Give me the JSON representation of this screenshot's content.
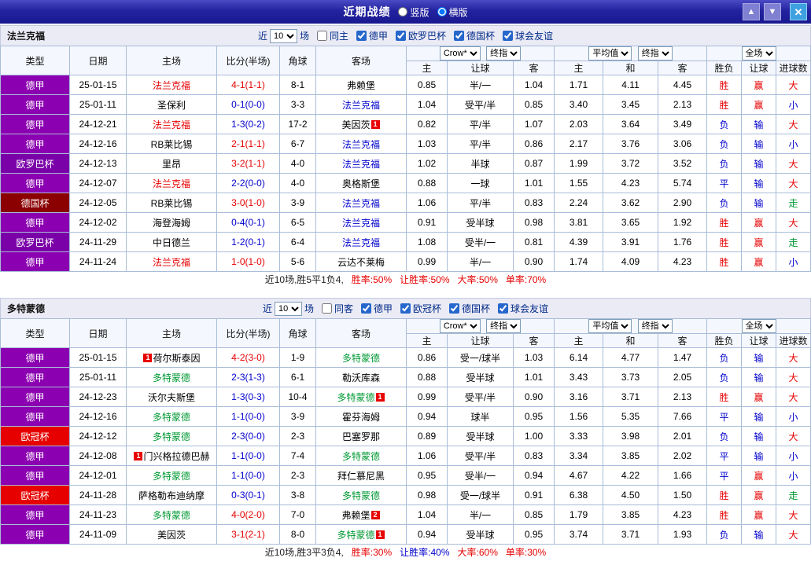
{
  "titlebar": {
    "title": "近期战绩",
    "vertical_label": "竖版",
    "horizontal_label": "横版",
    "vertical_selected": false,
    "horizontal_selected": true,
    "up_icon": "▲",
    "down_icon": "▼",
    "close_icon": "✕"
  },
  "tone_colors": {
    "red": "#E60000",
    "blue": "#0000CC",
    "green": "#009933",
    "dark": "#222222"
  },
  "league_colors": {
    "德甲": "#8B00B0",
    "欧罗巴杯": "#7A00A8",
    "德国杯": "#8B0000",
    "欧冠杯": "#E60000"
  },
  "filter_common": {
    "near_label": "近",
    "count_value": "10",
    "count_suffix": "场"
  },
  "table_header": {
    "type": "类型",
    "date": "日期",
    "home": "主场",
    "score": "比分(半场)",
    "corner": "角球",
    "away": "客场",
    "odds_company_select": "Crow*",
    "odds_time_select": "终指",
    "avg_select": "平均值",
    "avg_time_select": "终指",
    "fulltime_select": "全场",
    "odds_sub": [
      "主",
      "让球",
      "客"
    ],
    "avg_sub": [
      "主",
      "和",
      "客"
    ],
    "result_sub": [
      "胜负",
      "让球",
      "进球数"
    ]
  },
  "sections": [
    {
      "team": "法兰克福",
      "same_filter": {
        "label": "同主",
        "checked": false
      },
      "league_filters": [
        {
          "label": "德甲",
          "checked": true
        },
        {
          "label": "欧罗巴杯",
          "checked": true
        },
        {
          "label": "德国杯",
          "checked": true
        },
        {
          "label": "球会友谊",
          "checked": true
        }
      ],
      "rows": [
        {
          "league": "德甲",
          "date": "25-01-15",
          "home": {
            "name": "法兰克福",
            "tone": "red"
          },
          "score": {
            "text": "4-1(1-1)",
            "tone": "red"
          },
          "corner": "8-1",
          "away": {
            "name": "弗赖堡"
          },
          "odds": [
            "0.85",
            "半/一",
            "1.04"
          ],
          "avg": [
            "1.71",
            "4.11",
            "4.45"
          ],
          "results": [
            {
              "text": "胜",
              "tone": "red"
            },
            {
              "text": "赢",
              "tone": "red"
            },
            {
              "text": "大",
              "tone": "red"
            }
          ]
        },
        {
          "league": "德甲",
          "date": "25-01-11",
          "home": {
            "name": "圣保利"
          },
          "score": {
            "text": "0-1(0-0)",
            "tone": "blue"
          },
          "corner": "3-3",
          "away": {
            "name": "法兰克福",
            "tone": "blue"
          },
          "odds": [
            "1.04",
            "受平/半",
            "0.85"
          ],
          "avg": [
            "3.40",
            "3.45",
            "2.13"
          ],
          "results": [
            {
              "text": "胜",
              "tone": "red"
            },
            {
              "text": "赢",
              "tone": "red"
            },
            {
              "text": "小",
              "tone": "blue"
            }
          ]
        },
        {
          "league": "德甲",
          "date": "24-12-21",
          "home": {
            "name": "法兰克福",
            "tone": "red"
          },
          "score": {
            "text": "1-3(0-2)",
            "tone": "blue"
          },
          "corner": "17-2",
          "away": {
            "name": "美因茨",
            "badge_after": "1"
          },
          "odds": [
            "0.82",
            "平/半",
            "1.07"
          ],
          "avg": [
            "2.03",
            "3.64",
            "3.49"
          ],
          "results": [
            {
              "text": "负",
              "tone": "blue"
            },
            {
              "text": "输",
              "tone": "blue"
            },
            {
              "text": "大",
              "tone": "red"
            }
          ]
        },
        {
          "league": "德甲",
          "date": "24-12-16",
          "home": {
            "name": "RB莱比锡"
          },
          "score": {
            "text": "2-1(1-1)",
            "tone": "red"
          },
          "corner": "6-7",
          "away": {
            "name": "法兰克福",
            "tone": "blue"
          },
          "odds": [
            "1.03",
            "平/半",
            "0.86"
          ],
          "avg": [
            "2.17",
            "3.76",
            "3.06"
          ],
          "results": [
            {
              "text": "负",
              "tone": "blue"
            },
            {
              "text": "输",
              "tone": "blue"
            },
            {
              "text": "小",
              "tone": "blue"
            }
          ]
        },
        {
          "league": "欧罗巴杯",
          "date": "24-12-13",
          "home": {
            "name": "里昂"
          },
          "score": {
            "text": "3-2(1-1)",
            "tone": "red"
          },
          "corner": "4-0",
          "away": {
            "name": "法兰克福",
            "tone": "blue"
          },
          "odds": [
            "1.02",
            "半球",
            "0.87"
          ],
          "avg": [
            "1.99",
            "3.72",
            "3.52"
          ],
          "results": [
            {
              "text": "负",
              "tone": "blue"
            },
            {
              "text": "输",
              "tone": "blue"
            },
            {
              "text": "大",
              "tone": "red"
            }
          ]
        },
        {
          "league": "德甲",
          "date": "24-12-07",
          "home": {
            "name": "法兰克福",
            "tone": "red"
          },
          "score": {
            "text": "2-2(0-0)",
            "tone": "blue"
          },
          "corner": "4-0",
          "away": {
            "name": "奥格斯堡"
          },
          "odds": [
            "0.88",
            "一球",
            "1.01"
          ],
          "avg": [
            "1.55",
            "4.23",
            "5.74"
          ],
          "results": [
            {
              "text": "平",
              "tone": "blue"
            },
            {
              "text": "输",
              "tone": "blue"
            },
            {
              "text": "大",
              "tone": "red"
            }
          ]
        },
        {
          "league": "德国杯",
          "date": "24-12-05",
          "home": {
            "name": "RB莱比锡"
          },
          "score": {
            "text": "3-0(1-0)",
            "tone": "red"
          },
          "corner": "3-9",
          "away": {
            "name": "法兰克福",
            "tone": "blue"
          },
          "odds": [
            "1.06",
            "平/半",
            "0.83"
          ],
          "avg": [
            "2.24",
            "3.62",
            "2.90"
          ],
          "results": [
            {
              "text": "负",
              "tone": "blue"
            },
            {
              "text": "输",
              "tone": "blue"
            },
            {
              "text": "走",
              "tone": "green"
            }
          ]
        },
        {
          "league": "德甲",
          "date": "24-12-02",
          "home": {
            "name": "海登海姆"
          },
          "score": {
            "text": "0-4(0-1)",
            "tone": "blue"
          },
          "corner": "6-5",
          "away": {
            "name": "法兰克福",
            "tone": "blue"
          },
          "odds": [
            "0.91",
            "受半球",
            "0.98"
          ],
          "avg": [
            "3.81",
            "3.65",
            "1.92"
          ],
          "results": [
            {
              "text": "胜",
              "tone": "red"
            },
            {
              "text": "赢",
              "tone": "red"
            },
            {
              "text": "大",
              "tone": "red"
            }
          ]
        },
        {
          "league": "欧罗巴杯",
          "date": "24-11-29",
          "home": {
            "name": "中日德兰"
          },
          "score": {
            "text": "1-2(0-1)",
            "tone": "blue"
          },
          "corner": "6-4",
          "away": {
            "name": "法兰克福",
            "tone": "blue"
          },
          "odds": [
            "1.08",
            "受半/一",
            "0.81"
          ],
          "avg": [
            "4.39",
            "3.91",
            "1.76"
          ],
          "results": [
            {
              "text": "胜",
              "tone": "red"
            },
            {
              "text": "赢",
              "tone": "red"
            },
            {
              "text": "走",
              "tone": "green"
            }
          ]
        },
        {
          "league": "德甲",
          "date": "24-11-24",
          "home": {
            "name": "法兰克福",
            "tone": "red"
          },
          "score": {
            "text": "1-0(1-0)",
            "tone": "red"
          },
          "corner": "5-6",
          "away": {
            "name": "云达不莱梅"
          },
          "odds": [
            "0.99",
            "半/一",
            "0.90"
          ],
          "avg": [
            "1.74",
            "4.09",
            "4.23"
          ],
          "results": [
            {
              "text": "胜",
              "tone": "red"
            },
            {
              "text": "赢",
              "tone": "red"
            },
            {
              "text": "小",
              "tone": "blue"
            }
          ]
        }
      ],
      "summary": [
        {
          "text": "近10场,胜5平1负4,",
          "tone": "dark"
        },
        {
          "text": "胜率:50%",
          "tone": "red"
        },
        {
          "text": "让胜率:50%",
          "tone": "red"
        },
        {
          "text": "大率:50%",
          "tone": "red"
        },
        {
          "text": "单率:70%",
          "tone": "red"
        }
      ]
    },
    {
      "team": "多特蒙德",
      "same_filter": {
        "label": "同客",
        "checked": false
      },
      "league_filters": [
        {
          "label": "德甲",
          "checked": true
        },
        {
          "label": "欧冠杯",
          "checked": true
        },
        {
          "label": "德国杯",
          "checked": true
        },
        {
          "label": "球会友谊",
          "checked": true
        }
      ],
      "rows": [
        {
          "league": "德甲",
          "date": "25-01-15",
          "home": {
            "name": "荷尔斯泰因",
            "badge_before": "1"
          },
          "score": {
            "text": "4-2(3-0)",
            "tone": "red"
          },
          "corner": "1-9",
          "away": {
            "name": "多特蒙德",
            "tone": "green"
          },
          "odds": [
            "0.86",
            "受一/球半",
            "1.03"
          ],
          "avg": [
            "6.14",
            "4.77",
            "1.47"
          ],
          "results": [
            {
              "text": "负",
              "tone": "blue"
            },
            {
              "text": "输",
              "tone": "blue"
            },
            {
              "text": "大",
              "tone": "red"
            }
          ]
        },
        {
          "league": "德甲",
          "date": "25-01-11",
          "home": {
            "name": "多特蒙德",
            "tone": "green"
          },
          "score": {
            "text": "2-3(1-3)",
            "tone": "blue"
          },
          "corner": "6-1",
          "away": {
            "name": "勒沃库森"
          },
          "odds": [
            "0.88",
            "受半球",
            "1.01"
          ],
          "avg": [
            "3.43",
            "3.73",
            "2.05"
          ],
          "results": [
            {
              "text": "负",
              "tone": "blue"
            },
            {
              "text": "输",
              "tone": "blue"
            },
            {
              "text": "大",
              "tone": "red"
            }
          ]
        },
        {
          "league": "德甲",
          "date": "24-12-23",
          "home": {
            "name": "沃尔夫斯堡"
          },
          "score": {
            "text": "1-3(0-3)",
            "tone": "blue"
          },
          "corner": "10-4",
          "away": {
            "name": "多特蒙德",
            "tone": "green",
            "badge_after": "1"
          },
          "odds": [
            "0.99",
            "受平/半",
            "0.90"
          ],
          "avg": [
            "3.16",
            "3.71",
            "2.13"
          ],
          "results": [
            {
              "text": "胜",
              "tone": "red"
            },
            {
              "text": "赢",
              "tone": "red"
            },
            {
              "text": "大",
              "tone": "red"
            }
          ]
        },
        {
          "league": "德甲",
          "date": "24-12-16",
          "home": {
            "name": "多特蒙德",
            "tone": "green"
          },
          "score": {
            "text": "1-1(0-0)",
            "tone": "blue"
          },
          "corner": "3-9",
          "away": {
            "name": "霍芬海姆"
          },
          "odds": [
            "0.94",
            "球半",
            "0.95"
          ],
          "avg": [
            "1.56",
            "5.35",
            "7.66"
          ],
          "results": [
            {
              "text": "平",
              "tone": "blue"
            },
            {
              "text": "输",
              "tone": "blue"
            },
            {
              "text": "小",
              "tone": "blue"
            }
          ]
        },
        {
          "league": "欧冠杯",
          "date": "24-12-12",
          "home": {
            "name": "多特蒙德",
            "tone": "green"
          },
          "score": {
            "text": "2-3(0-0)",
            "tone": "blue"
          },
          "corner": "2-3",
          "away": {
            "name": "巴塞罗那"
          },
          "odds": [
            "0.89",
            "受半球",
            "1.00"
          ],
          "avg": [
            "3.33",
            "3.98",
            "2.01"
          ],
          "results": [
            {
              "text": "负",
              "tone": "blue"
            },
            {
              "text": "输",
              "tone": "blue"
            },
            {
              "text": "大",
              "tone": "red"
            }
          ]
        },
        {
          "league": "德甲",
          "date": "24-12-08",
          "home": {
            "name": "门兴格拉德巴赫",
            "badge_before": "1"
          },
          "score": {
            "text": "1-1(0-0)",
            "tone": "blue"
          },
          "corner": "7-4",
          "away": {
            "name": "多特蒙德",
            "tone": "green"
          },
          "odds": [
            "1.06",
            "受平/半",
            "0.83"
          ],
          "avg": [
            "3.34",
            "3.85",
            "2.02"
          ],
          "results": [
            {
              "text": "平",
              "tone": "blue"
            },
            {
              "text": "输",
              "tone": "blue"
            },
            {
              "text": "小",
              "tone": "blue"
            }
          ]
        },
        {
          "league": "德甲",
          "date": "24-12-01",
          "home": {
            "name": "多特蒙德",
            "tone": "green"
          },
          "score": {
            "text": "1-1(0-0)",
            "tone": "blue"
          },
          "corner": "2-3",
          "away": {
            "name": "拜仁慕尼黑"
          },
          "odds": [
            "0.95",
            "受半/一",
            "0.94"
          ],
          "avg": [
            "4.67",
            "4.22",
            "1.66"
          ],
          "results": [
            {
              "text": "平",
              "tone": "blue"
            },
            {
              "text": "赢",
              "tone": "red"
            },
            {
              "text": "小",
              "tone": "blue"
            }
          ]
        },
        {
          "league": "欧冠杯",
          "date": "24-11-28",
          "home": {
            "name": "萨格勒布迪纳摩"
          },
          "score": {
            "text": "0-3(0-1)",
            "tone": "blue"
          },
          "corner": "3-8",
          "away": {
            "name": "多特蒙德",
            "tone": "green"
          },
          "odds": [
            "0.98",
            "受一/球半",
            "0.91"
          ],
          "avg": [
            "6.38",
            "4.50",
            "1.50"
          ],
          "results": [
            {
              "text": "胜",
              "tone": "red"
            },
            {
              "text": "赢",
              "tone": "red"
            },
            {
              "text": "走",
              "tone": "green"
            }
          ]
        },
        {
          "league": "德甲",
          "date": "24-11-23",
          "home": {
            "name": "多特蒙德",
            "tone": "green"
          },
          "score": {
            "text": "4-0(2-0)",
            "tone": "red"
          },
          "corner": "7-0",
          "away": {
            "name": "弗赖堡",
            "badge_after": "2"
          },
          "odds": [
            "1.04",
            "半/一",
            "0.85"
          ],
          "avg": [
            "1.79",
            "3.85",
            "4.23"
          ],
          "results": [
            {
              "text": "胜",
              "tone": "red"
            },
            {
              "text": "赢",
              "tone": "red"
            },
            {
              "text": "大",
              "tone": "red"
            }
          ]
        },
        {
          "league": "德甲",
          "date": "24-11-09",
          "home": {
            "name": "美因茨"
          },
          "score": {
            "text": "3-1(2-1)",
            "tone": "red"
          },
          "corner": "8-0",
          "away": {
            "name": "多特蒙德",
            "tone": "green",
            "badge_after": "1"
          },
          "odds": [
            "0.94",
            "受半球",
            "0.95"
          ],
          "avg": [
            "3.74",
            "3.71",
            "1.93"
          ],
          "results": [
            {
              "text": "负",
              "tone": "blue"
            },
            {
              "text": "输",
              "tone": "blue"
            },
            {
              "text": "大",
              "tone": "red"
            }
          ]
        }
      ],
      "summary": [
        {
          "text": "近10场,胜3平3负4,",
          "tone": "dark"
        },
        {
          "text": "胜率:30%",
          "tone": "red"
        },
        {
          "text": "让胜率:40%",
          "tone": "blue"
        },
        {
          "text": "大率:60%",
          "tone": "red"
        },
        {
          "text": "单率:30%",
          "tone": "red"
        }
      ]
    }
  ]
}
